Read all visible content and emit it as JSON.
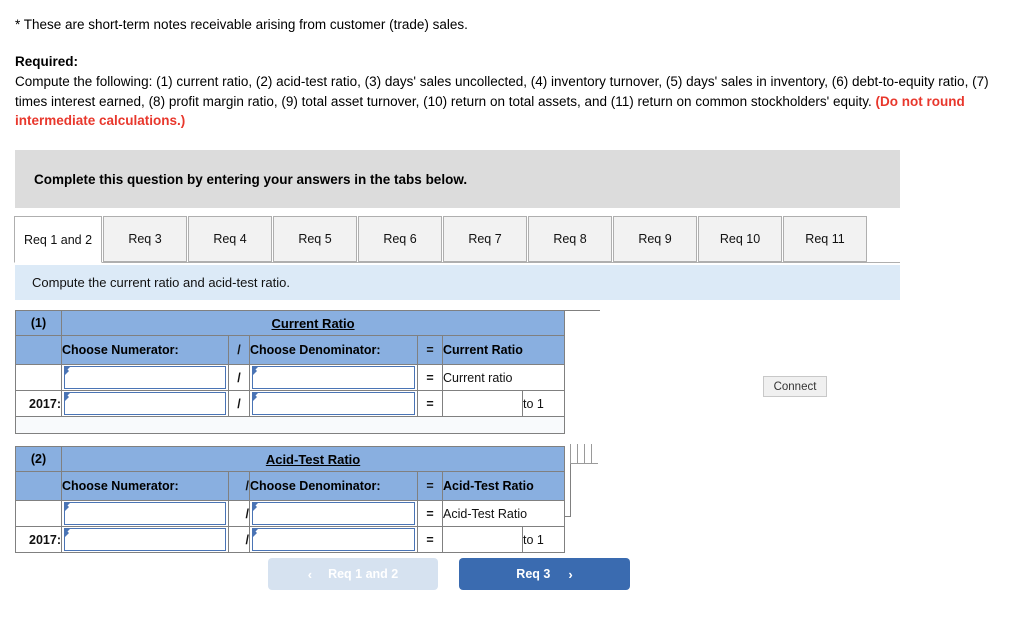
{
  "intro": {
    "footnote": "* These are short-term notes receivable arising from customer (trade) sales.",
    "required_heading": "Required:",
    "required_body": "Compute the following: (1) current ratio, (2) acid-test ratio, (3) days' sales uncollected, (4) inventory turnover, (5) days' sales in inventory, (6) debt-to-equity ratio, (7) times interest earned, (8) profit margin ratio, (9) total asset turnover, (10) return on total assets, and (11) return on common stockholders' equity. ",
    "required_warning": "(Do not round intermediate calculations.)"
  },
  "banner": {
    "text": "Complete this question by entering your answers in the tabs below."
  },
  "tabs": [
    {
      "label": "Req 1 and 2",
      "active": true
    },
    {
      "label": "Req 3",
      "active": false
    },
    {
      "label": "Req 4",
      "active": false
    },
    {
      "label": "Req 5",
      "active": false
    },
    {
      "label": "Req 6",
      "active": false
    },
    {
      "label": "Req 7",
      "active": false
    },
    {
      "label": "Req 8",
      "active": false
    },
    {
      "label": "Req 9",
      "active": false
    },
    {
      "label": "Req 10",
      "active": false
    },
    {
      "label": "Req 11",
      "active": false
    }
  ],
  "sub_instruction": {
    "text": "Compute the current ratio and acid-test ratio."
  },
  "tables": {
    "current_ratio": {
      "index_label": "(1)",
      "title": "Current Ratio",
      "numerator_header": "Choose Numerator:",
      "operator": "/",
      "denominator_header": "Choose Denominator:",
      "equals": "=",
      "result_header": "Current Ratio",
      "row1": {
        "row_label": "",
        "numerator_value": "",
        "operator": "/",
        "denominator_value": "",
        "equals": "=",
        "result_label": "Current ratio"
      },
      "row2": {
        "row_label": "2017:",
        "numerator_value": "",
        "operator": "/",
        "denominator_value": "",
        "equals": "=",
        "result_value": "",
        "result_suffix": "to 1"
      }
    },
    "acid_test_ratio": {
      "index_label": "(2)",
      "title": "Acid-Test Ratio",
      "numerator_header": "Choose Numerator:",
      "operator": "/",
      "denominator_header": "Choose Denominator:",
      "equals": "=",
      "result_header": "Acid-Test Ratio",
      "row1": {
        "row_label": "",
        "numerator_value": "",
        "operator": "/",
        "denominator_value": "",
        "equals": "=",
        "result_label": "Acid-Test Ratio"
      },
      "row2": {
        "row_label": "2017:",
        "numerator_value": "",
        "operator": "/",
        "denominator_value": "",
        "equals": "=",
        "result_value": "",
        "result_suffix": "to 1"
      }
    }
  },
  "connect_badge": {
    "label": "Connect"
  },
  "nav": {
    "prev_label": "Req 1 and 2",
    "prev_chevron": "‹",
    "next_label": "Req 3",
    "next_chevron": "›"
  },
  "colors": {
    "header_blue": "#89AFE0",
    "light_blue_bar": "#DCEAF7",
    "gray_banner": "#DCDCDC",
    "warning_red": "#E8372C",
    "primary_button": "#3A6BB0",
    "disabled_button": "#D6E2F0",
    "input_border": "#4A74B5"
  }
}
